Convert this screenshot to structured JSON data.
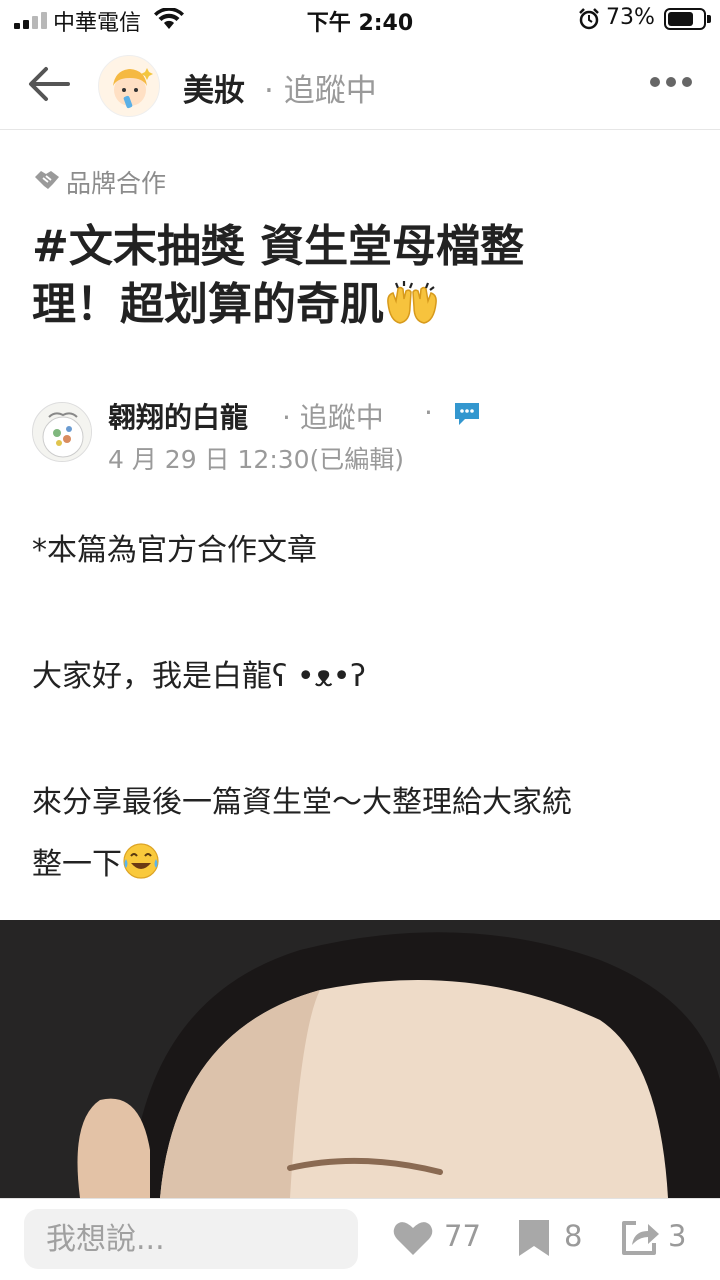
{
  "status_bar": {
    "carrier": "中華電信",
    "time": "下午 2:40",
    "battery_percent": "73%",
    "battery_level": 0.73
  },
  "header": {
    "board_name": "美妝",
    "follow_status": "· 追蹤中"
  },
  "post": {
    "tag": "品牌合作",
    "title_line1": "#文末抽獎 資生堂母檔整",
    "title_line2": "理！超划算的奇肌",
    "author": {
      "name": "翱翔的白龍",
      "follow_status": "· 追蹤中",
      "separator": "·",
      "timestamp": "4 月 29 日 12:30(已編輯)"
    },
    "body": {
      "line1": "*本篇為官方合作文章",
      "line2": "大家好，我是白龍ʕ •ᴥ•ʔ",
      "line3a": "來分享最後一篇資生堂～大整理給大家統",
      "line3b": "整一下"
    }
  },
  "bottom_bar": {
    "comment_placeholder": "我想說...",
    "likes": "77",
    "saves": "8",
    "shares": "3"
  },
  "colors": {
    "text": "#222222",
    "muted": "#9a9a9a",
    "accent_blue": "#3397cf",
    "photo_bg": "#262525"
  }
}
